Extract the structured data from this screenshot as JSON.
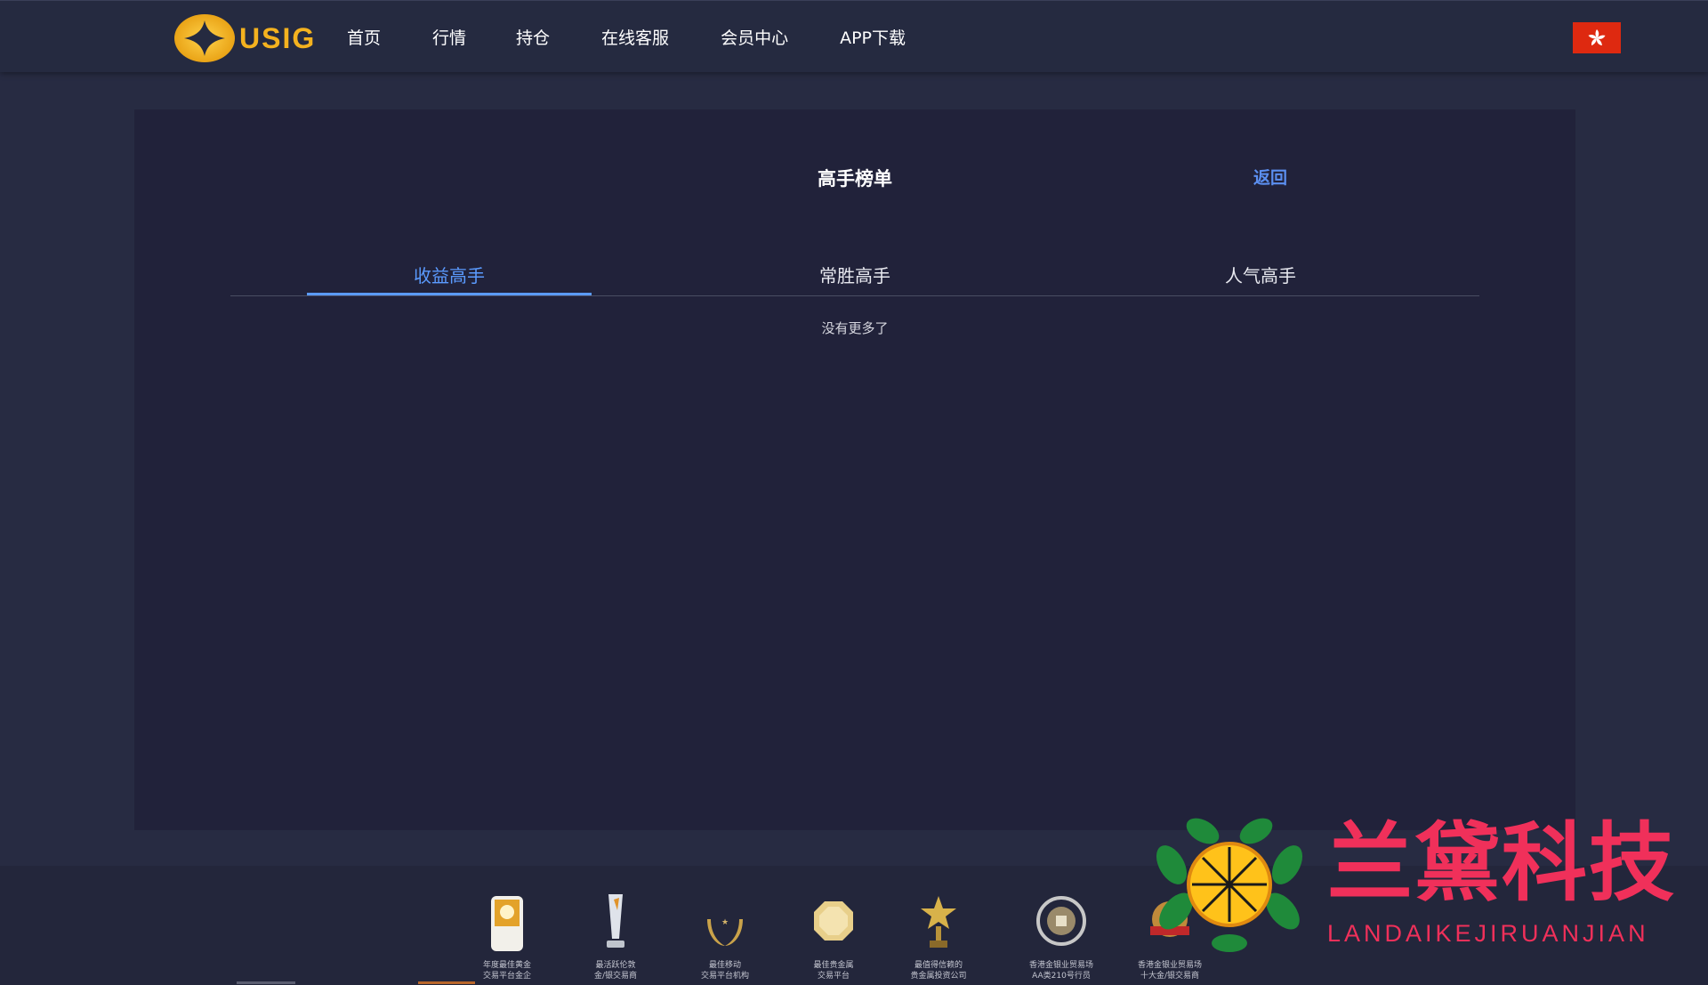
{
  "header": {
    "logo_text": "USIG",
    "nav": [
      "首页",
      "行情",
      "持仓",
      "在线客服",
      "会员中心",
      "APP下载"
    ],
    "flag_icon": "hong-kong-flag-icon"
  },
  "page": {
    "title": "高手榜单",
    "back_label": "返回",
    "tabs": [
      "收益高手",
      "常胜高手",
      "人气高手"
    ],
    "active_tab": 0,
    "empty_text": "没有更多了"
  },
  "footer": {
    "awards": [
      {
        "caption": "年度最佳黄金\n交易平台金企"
      },
      {
        "caption": "最活跃伦敦\n金/银交易商"
      },
      {
        "caption": "最佳移动\n交易平台机构"
      },
      {
        "caption": "最佳贵金属\n交易平台"
      },
      {
        "caption": "最值得信赖的\n贵金属投资公司"
      },
      {
        "caption": "香港金银业贸易场\nAA类210号行员"
      },
      {
        "caption": "香港金银业贸易场\n十大金/银交易商"
      }
    ]
  },
  "watermark": {
    "title": "兰黛科技",
    "subtitle": "LANDAIKEJIRUANJIAN"
  },
  "colors": {
    "accent": "#5b9bff",
    "logo_gold": "#f4b21f",
    "watermark": "#f0305a"
  }
}
